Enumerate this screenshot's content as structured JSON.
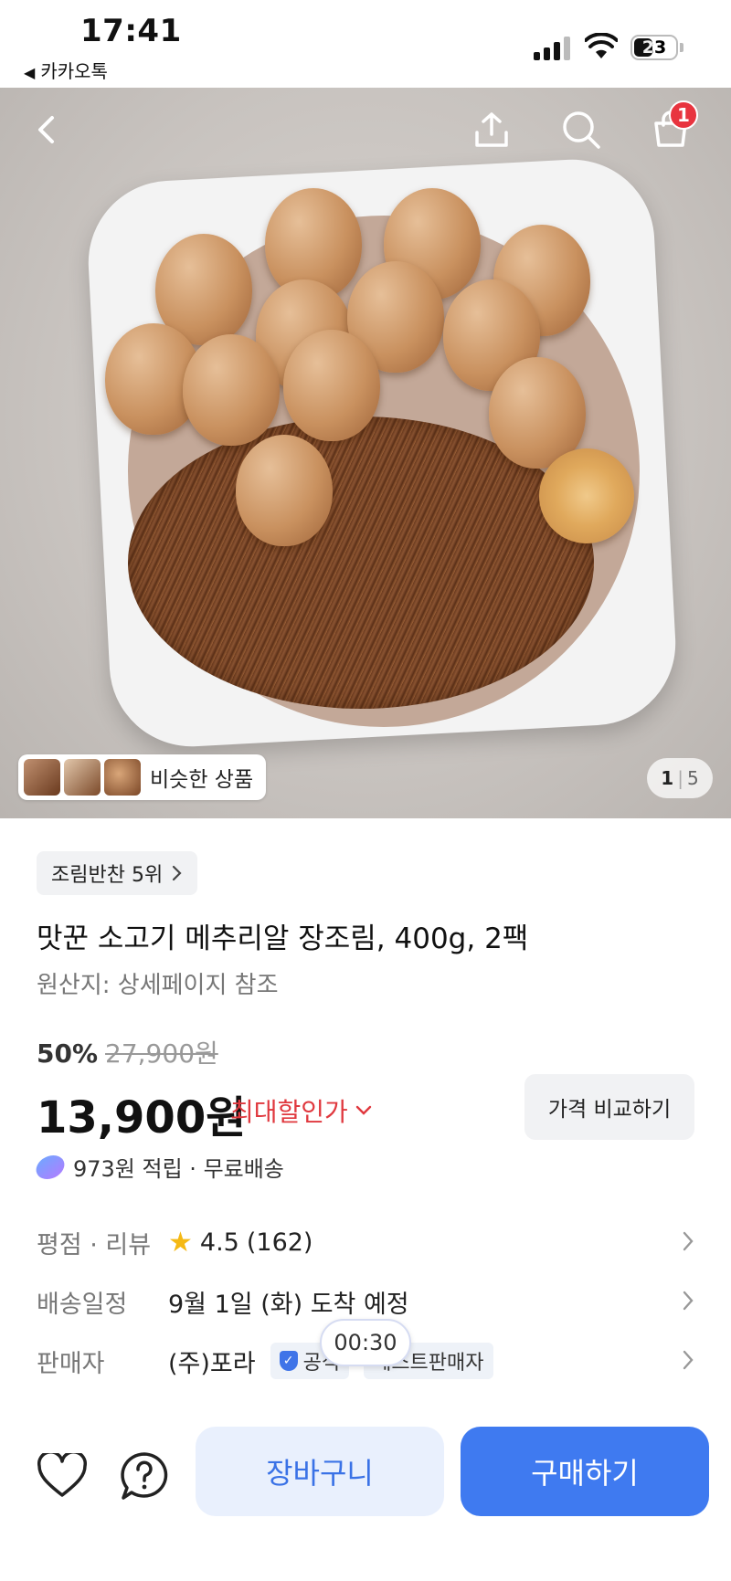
{
  "status_bar": {
    "time": "17:41",
    "back_app": "카카오톡",
    "battery": "23"
  },
  "header": {
    "cart_badge": "1",
    "icons": [
      "back-arrow-icon",
      "share-icon",
      "search-icon",
      "cart-icon"
    ]
  },
  "gallery": {
    "similar_label": "비슷한 상품",
    "page_current": "1",
    "page_total": "5"
  },
  "product": {
    "rank_chip": "조림반찬 5위",
    "title": "맛꾼 소고기 메추리알 장조림, 400g, 2팩",
    "origin": "원산지: 상세페이지 참조",
    "discount_rate": "50%",
    "original_price": "27,900원",
    "price": "13,900원",
    "max_deal_label": "최대할인가",
    "compare_label": "가격 비교하기",
    "points_text": "973원 적립 · 무료배송"
  },
  "details": {
    "rating_key": "평점 · 리뷰",
    "rating_value": "4.5",
    "review_count": "(162)",
    "delivery_key": "배송일정",
    "delivery_value": "9월 1일 (화) 도착 예정",
    "seller_key": "판매자",
    "seller_value": "(주)포라",
    "official_tag": "공식",
    "best_seller_tag": "베스트판매자"
  },
  "timer": "00:30",
  "bottom_bar": {
    "cart_label": "장바구니",
    "buy_label": "구매하기"
  },
  "colors": {
    "accent_blue": "#3f7af0",
    "sale_red": "#e0383e",
    "badge_red": "#e8343f"
  }
}
